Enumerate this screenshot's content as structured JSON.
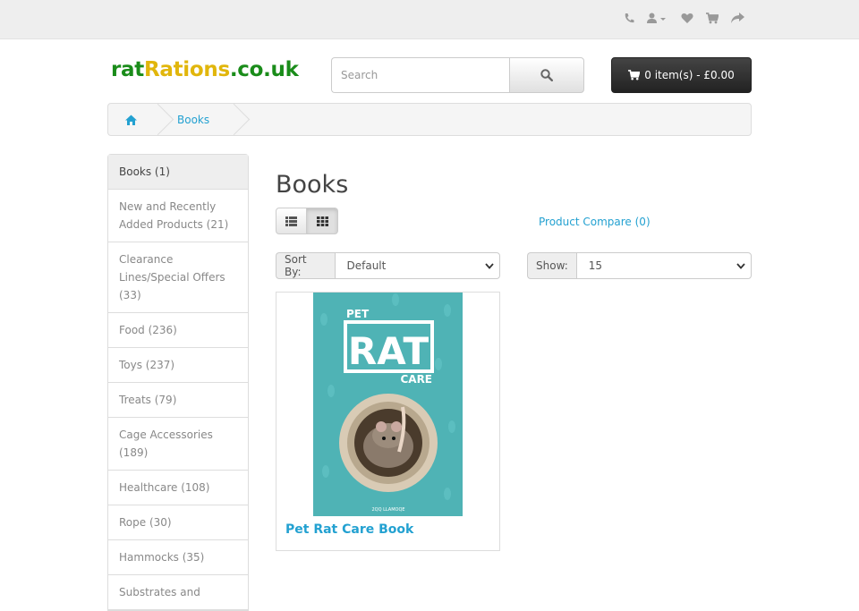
{
  "topbar": {
    "icons": [
      "phone-icon",
      "user-icon",
      "heart-icon",
      "shopping-cart-icon",
      "share-icon"
    ]
  },
  "header": {
    "logo": {
      "part1": "rat",
      "part2": "Rations",
      "part3": ".co.uk"
    },
    "search_placeholder": "Search",
    "cart_label": "0 item(s) - £0.00"
  },
  "breadcrumb": {
    "items": [
      {
        "label": "Books"
      }
    ]
  },
  "sidebar": {
    "items": [
      {
        "label": "Books (1)"
      },
      {
        "label": "New and Recently Added Products (21)"
      },
      {
        "label": "Clearance Lines/Special Offers (33)"
      },
      {
        "label": "Food (236)"
      },
      {
        "label": "Toys (237)"
      },
      {
        "label": "Treats (79)"
      },
      {
        "label": "Cage Accessories (189)"
      },
      {
        "label": "Healthcare (108)"
      },
      {
        "label": "Rope (30)"
      },
      {
        "label": "Hammocks (35)"
      },
      {
        "label": "Substrates and"
      }
    ]
  },
  "main": {
    "title": "Books",
    "compare_label": "Product Compare (0)",
    "sort_label": "Sort By:",
    "sort_value": "Default",
    "show_label": "Show:",
    "show_value": "15"
  },
  "product": {
    "name": "Pet Rat Care Book",
    "cover": {
      "line1": "PET",
      "line2": "RAT",
      "line3": "CARE",
      "publisher": "2QQ LLAMOQE"
    }
  },
  "colors": {
    "link": "#23a1d1",
    "logo_green": "#1a8c1a",
    "logo_yellow": "#e1b60c",
    "cover_teal": "#4fb3b5"
  }
}
